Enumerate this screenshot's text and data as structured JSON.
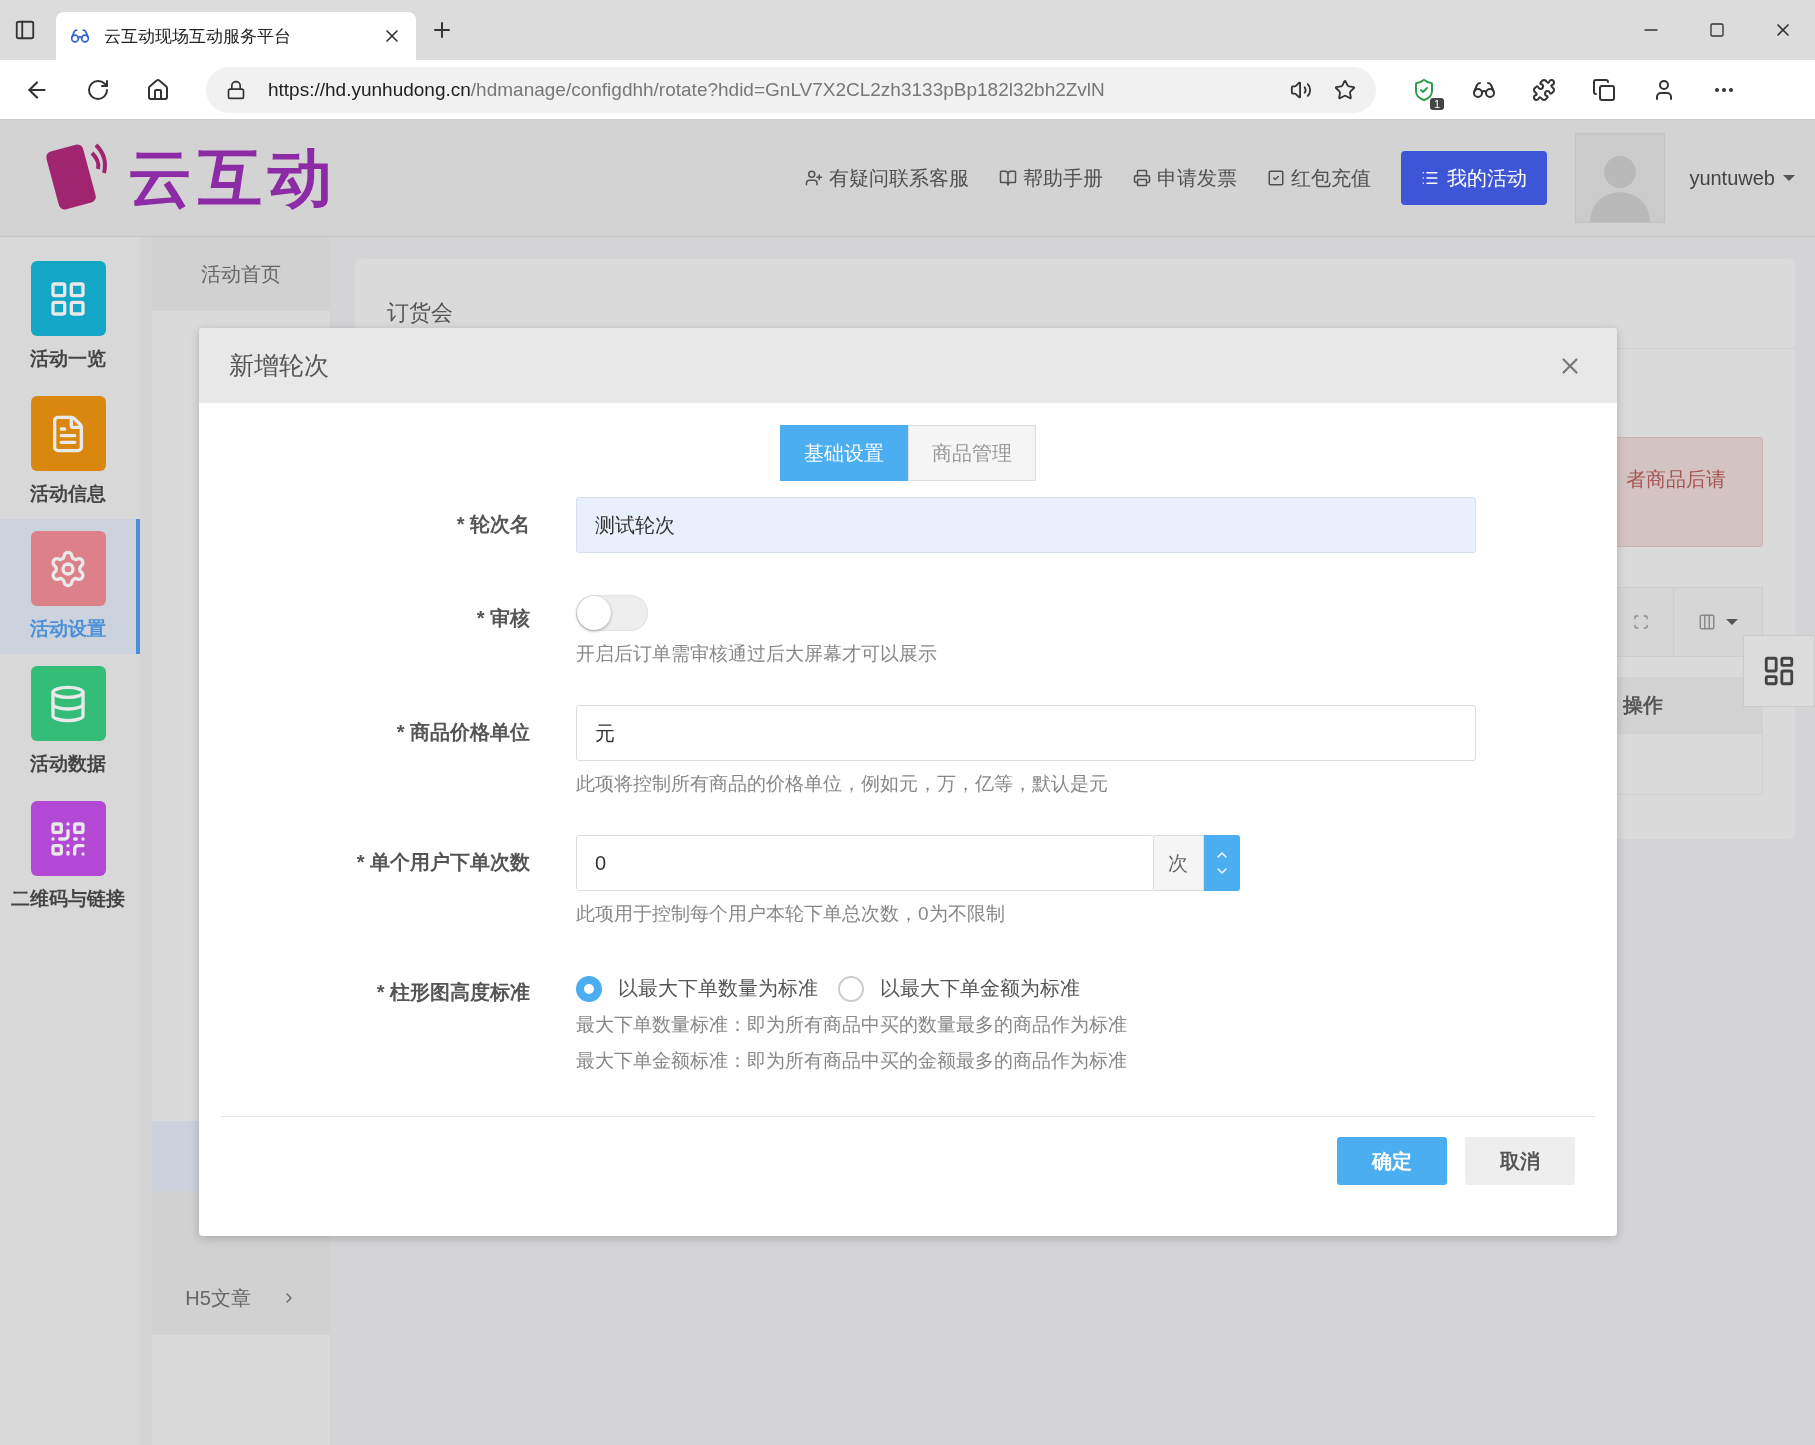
{
  "browser": {
    "tab_title": "云互动现场互动服务平台",
    "url_host": "https://hd.yunhudong.cn",
    "url_path": "/hdmanage/configdhh/rotate?hdid=GnLV7X2CL2zh3133pBp182l32bh2ZvlN",
    "extension_badge": "1"
  },
  "header": {
    "logo_text": "云互动",
    "nav": [
      "有疑问联系客服",
      "帮助手册",
      "申请发票",
      "红包充值"
    ],
    "primary_button": "我的活动",
    "user": "yuntuweb"
  },
  "sidebar": {
    "items": [
      {
        "label": "活动一览",
        "selected": false,
        "color": "#14a6c6"
      },
      {
        "label": "活动信息",
        "selected": false,
        "color": "#d9870f"
      },
      {
        "label": "活动设置",
        "selected": true,
        "color": "#dc8189"
      },
      {
        "label": "活动数据",
        "selected": false,
        "color": "#33bd77"
      },
      {
        "label": "二维码与链接",
        "selected": false,
        "color": "#b348d5"
      }
    ]
  },
  "subnav": {
    "items": [
      {
        "label": "活动首页",
        "has_children": false
      },
      {
        "label": "H5文章",
        "has_children": true
      }
    ]
  },
  "main": {
    "title": "订货会",
    "alert_text": "者商品后请",
    "table_header": "操作"
  },
  "dialog": {
    "title": "新增轮次",
    "tabs": [
      {
        "label": "基础设置",
        "selected": true
      },
      {
        "label": "商品管理",
        "selected": false
      }
    ],
    "fields": [
      {
        "kind": "text",
        "label": "* 轮次名",
        "value": "测试轮次",
        "focused": true
      },
      {
        "kind": "switch",
        "label": "* 审核",
        "on": false,
        "help": "开启后订单需审核通过后大屏幕才可以展示"
      },
      {
        "kind": "text",
        "label": "* 商品价格单位",
        "value": "元",
        "focused": false,
        "help": "此项将控制所有商品的价格单位，例如元，万，亿等，默认是元"
      },
      {
        "kind": "number",
        "label": "* 单个用户下单次数",
        "value": "0",
        "addon": "次",
        "help": "此项用于控制每个用户本轮下单总次数，0为不限制"
      },
      {
        "kind": "radio",
        "label": "* 柱形图高度标准",
        "options": [
          {
            "label": "以最大下单数量为标准",
            "selected": true
          },
          {
            "label": "以最大下单金额为标准",
            "selected": false
          }
        ],
        "help_lines": [
          "最大下单数量标准：即为所有商品中买的数量最多的商品作为标准",
          "最大下单金额标准：即为所有商品中买的金额最多的商品作为标准"
        ]
      }
    ],
    "buttons": [
      {
        "label": "确定",
        "kind": "primary"
      },
      {
        "label": "取消",
        "kind": "default"
      }
    ]
  }
}
